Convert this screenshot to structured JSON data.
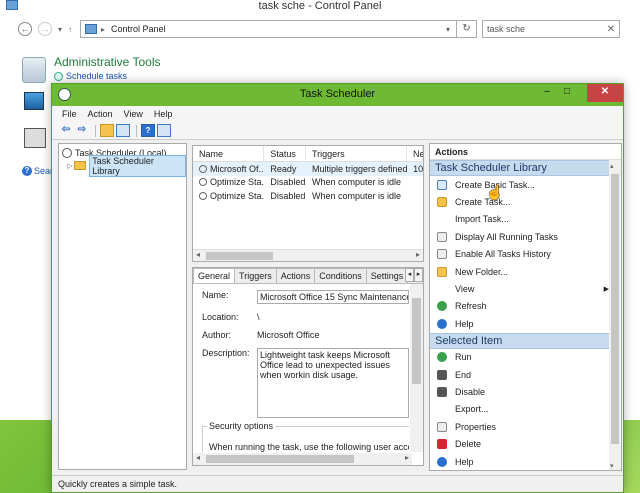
{
  "control_panel": {
    "window_title": "task sche - Control Panel",
    "address_crumb": "Control Panel",
    "search_value": "task sche",
    "result_title": "Administrative Tools",
    "result_link": "Schedule tasks",
    "help_text": "Sear"
  },
  "task_scheduler": {
    "title": "Task Scheduler",
    "menu": [
      "File",
      "Action",
      "View",
      "Help"
    ],
    "tree": {
      "root": "Task Scheduler (Local)",
      "child": "Task Scheduler Library"
    },
    "list": {
      "columns": [
        "Name",
        "Status",
        "Triggers",
        "Ne"
      ],
      "rows": [
        {
          "name": "Microsoft Of...",
          "status": "Ready",
          "triggers": "Multiple triggers defined",
          "next": "10"
        },
        {
          "name": "Optimize Sta...",
          "status": "Disabled",
          "triggers": "When computer is idle",
          "next": ""
        },
        {
          "name": "Optimize Sta...",
          "status": "Disabled",
          "triggers": "When computer is idle",
          "next": ""
        }
      ]
    },
    "detail": {
      "tabs": [
        "General",
        "Triggers",
        "Actions",
        "Conditions",
        "Settings"
      ],
      "name_label": "Name:",
      "name_value": "Microsoft Office 15 Sync Maintenance f",
      "location_label": "Location:",
      "location_value": "\\",
      "author_label": "Author:",
      "author_value": "Microsoft Office",
      "description_label": "Description:",
      "description_value": "Lightweight task keeps Microsoft Office lead to unexpected issues when workin disk usage.",
      "security_title": "Security options",
      "security_text": "When running the task, use the following user accou"
    },
    "actions": {
      "header": "Actions",
      "library_section": "Task Scheduler Library",
      "library_items": [
        {
          "label": "Create Basic Task...",
          "icon": "create-basic-task-icon",
          "color": "blue"
        },
        {
          "label": "Create Task...",
          "icon": "create-task-icon",
          "color": "yellow"
        },
        {
          "label": "Import Task...",
          "icon": "",
          "color": ""
        },
        {
          "label": "Display All Running Tasks",
          "icon": "running-tasks-icon",
          "color": "gray"
        },
        {
          "label": "Enable All Tasks History",
          "icon": "history-icon",
          "color": "gray"
        },
        {
          "label": "New Folder...",
          "icon": "folder-icon",
          "color": "yellow"
        },
        {
          "label": "View",
          "icon": "",
          "color": "",
          "submenu": true
        },
        {
          "label": "Refresh",
          "icon": "refresh-icon",
          "color": "green"
        },
        {
          "label": "Help",
          "icon": "help-icon",
          "color": "help"
        }
      ],
      "selected_section": "Selected Item",
      "selected_items": [
        {
          "label": "Run",
          "icon": "run-icon",
          "color": "green"
        },
        {
          "label": "End",
          "icon": "end-icon",
          "color": "dark"
        },
        {
          "label": "Disable",
          "icon": "disable-icon",
          "color": "dark"
        },
        {
          "label": "Export...",
          "icon": "",
          "color": ""
        },
        {
          "label": "Properties",
          "icon": "properties-icon",
          "color": "gray"
        },
        {
          "label": "Delete",
          "icon": "delete-icon",
          "color": "red"
        },
        {
          "label": "Help",
          "icon": "help-icon",
          "color": "help"
        }
      ]
    },
    "status_bar": "Quickly creates a simple task."
  }
}
